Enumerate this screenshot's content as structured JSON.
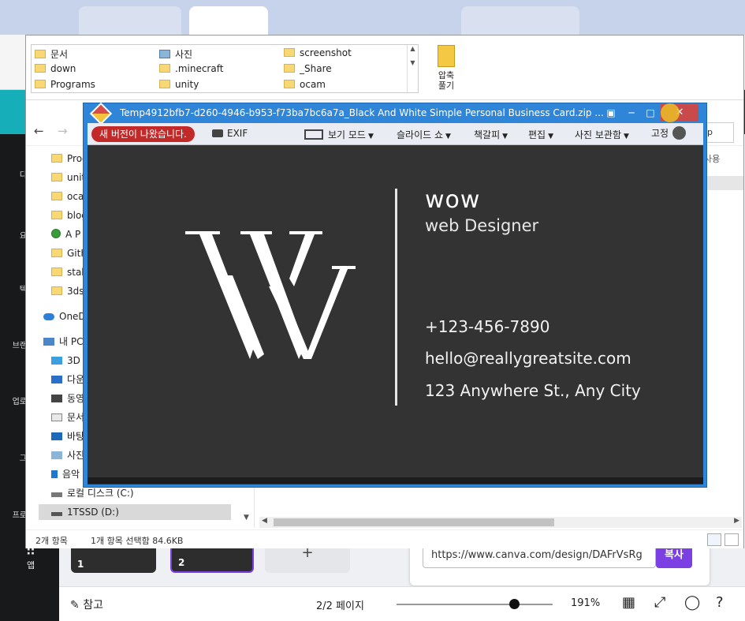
{
  "viewer": {
    "title": "Temp4912bfb7-d260-4946-b953-f73ba7bc6a7a_Black And White Simple Personal Business Card.zip ...",
    "update_badge": "새 버전이 나왔습니다.",
    "toolbar": {
      "exif": "EXIF",
      "view_mode": "보기 모드",
      "slideshow": "슬라이드 쇼",
      "bookmark": "책갈피",
      "edit": "편집",
      "photo_storage": "사진 보관함",
      "pin": "고정"
    },
    "card": {
      "name": "wow",
      "role": "web Designer",
      "phone": "+123-456-7890",
      "email": "hello@reallygreatsite.com",
      "address": "123 Anywhere St., Any City"
    },
    "controls": {
      "minimize": "─",
      "maximize": "□",
      "close": "✕",
      "restore": "▣"
    }
  },
  "explorer": {
    "ribbon_items": [
      "문서",
      "사진",
      "screenshot",
      "down",
      ".minecraft",
      "_Share",
      "Programs",
      "unity",
      "ocam"
    ],
    "extract_label_1": "압축",
    "extract_label_2": "풀기",
    "tree": [
      "Prog",
      "unit",
      "oca",
      "blog",
      "A P",
      "GitH",
      "stab",
      "3ds",
      "OneD",
      "내 PC",
      "3D",
      "다운",
      "동영",
      "문서",
      "바탕",
      "사진",
      "음악",
      "로컬 디스크 (C:)",
      "1TSSD (D:)"
    ],
    "search_fragment": "p",
    "column_fragment": "사용",
    "status_count": "2개 항목",
    "status_selected": "1개 항목 선택함 84.6KB"
  },
  "canva": {
    "sidebar": [
      "디",
      "요",
      "텍",
      "브랜",
      "업로",
      "그",
      "프로"
    ],
    "apps": "앱",
    "notes": "참고",
    "page_indicator": "2/2 페이지",
    "zoom": "191%",
    "zoom_level": 0.75,
    "thumb_1": "1",
    "thumb_2": "2",
    "share_url": "https://www.canva.com/design/DAFrVsRg",
    "copy": "복사",
    "add_page": "+"
  },
  "colors": {
    "viewer_blue": "#2f86d9",
    "card_bg": "#333333",
    "update_red": "#c22a2a",
    "canva_purple": "#7b3fe4",
    "canva_teal": "#16aeb9"
  }
}
